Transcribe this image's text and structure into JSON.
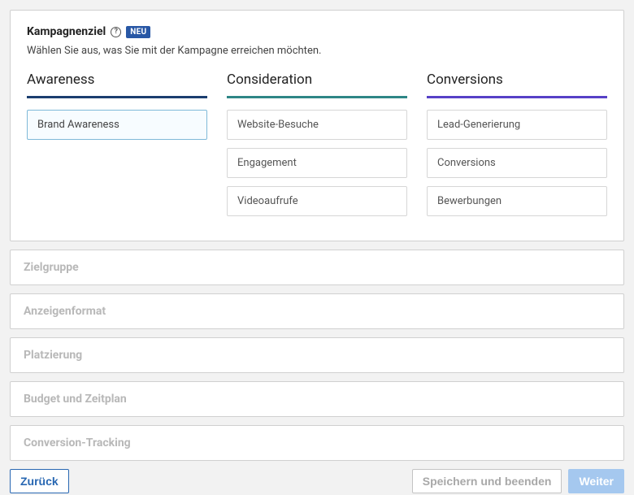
{
  "main": {
    "title": "Kampagnenziel",
    "badge": "NEU",
    "subtitle": "Wählen Sie aus, was Sie mit der Kampagne erreichen möchten.",
    "columns": {
      "awareness": {
        "title": "Awareness",
        "options": [
          "Brand Awareness"
        ]
      },
      "consideration": {
        "title": "Consideration",
        "options": [
          "Website-Besuche",
          "Engagement",
          "Videoaufrufe"
        ]
      },
      "conversions": {
        "title": "Conversions",
        "options": [
          "Lead-Generierung",
          "Conversions",
          "Bewerbungen"
        ]
      }
    }
  },
  "collapsed_sections": [
    "Zielgruppe",
    "Anzeigenformat",
    "Platzierung",
    "Budget und Zeitplan",
    "Conversion-Tracking"
  ],
  "footer": {
    "back": "Zurück",
    "save": "Speichern und beenden",
    "next": "Weiter"
  }
}
